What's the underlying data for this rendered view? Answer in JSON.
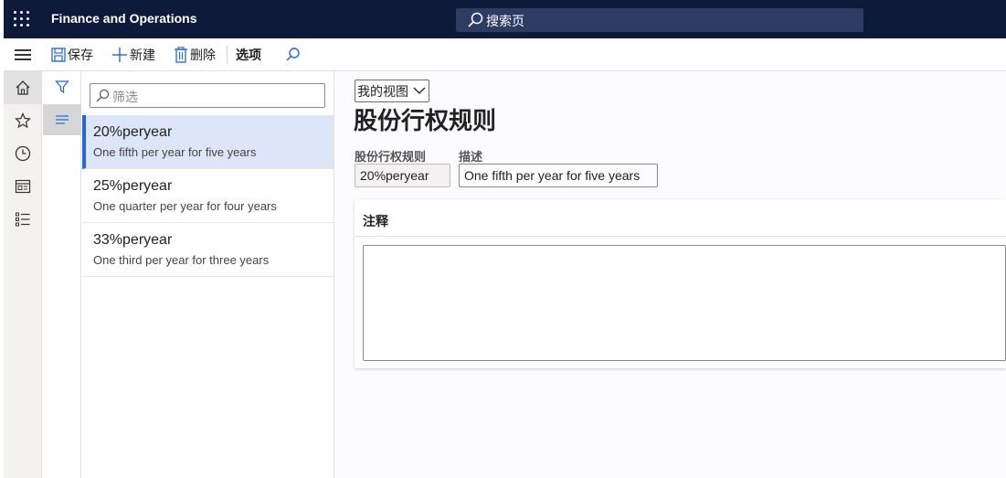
{
  "app": {
    "title": "Finance and Operations"
  },
  "search": {
    "placeholder": "搜索页"
  },
  "toolbar": {
    "save_label": "保存",
    "new_label": "新建",
    "delete_label": "删除",
    "options_label": "选项"
  },
  "nav": {
    "items": [
      "home-icon",
      "star-icon",
      "clock-icon",
      "workspace-icon",
      "modules-icon"
    ]
  },
  "list": {
    "filter_placeholder": "筛选",
    "records": [
      {
        "title": "20%peryear",
        "description": "One fifth per year for five years"
      },
      {
        "title": "25%peryear",
        "description": "One quarter per year for four years"
      },
      {
        "title": "33%peryear",
        "description": "One third per year for three years"
      }
    ],
    "selected_index": 0
  },
  "main": {
    "view_selector": "我的视图",
    "page_title": "股份行权规则",
    "fields": {
      "rule_label": "股份行权规则",
      "rule_value": "20%peryear",
      "description_label": "描述",
      "description_value": "One fifth per year for five years"
    },
    "notes": {
      "title": "注释",
      "value": ""
    }
  },
  "colors": {
    "topbar": "#0e1a3a",
    "accent": "#2266e3",
    "selected_row": "#dde6f8"
  }
}
